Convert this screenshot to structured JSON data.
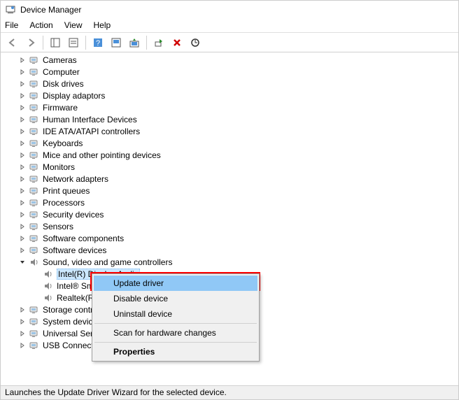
{
  "window": {
    "title": "Device Manager"
  },
  "menu": {
    "file": "File",
    "action": "Action",
    "view": "View",
    "help": "Help"
  },
  "tree": [
    {
      "label": "Cameras",
      "icon": "camera",
      "depth": 1,
      "arrow": "right"
    },
    {
      "label": "Computer",
      "icon": "computer",
      "depth": 1,
      "arrow": "right"
    },
    {
      "label": "Disk drives",
      "icon": "disk",
      "depth": 1,
      "arrow": "right"
    },
    {
      "label": "Display adaptors",
      "icon": "display",
      "depth": 1,
      "arrow": "right"
    },
    {
      "label": "Firmware",
      "icon": "chip",
      "depth": 1,
      "arrow": "right"
    },
    {
      "label": "Human Interface Devices",
      "icon": "hid",
      "depth": 1,
      "arrow": "right"
    },
    {
      "label": "IDE ATA/ATAPI controllers",
      "icon": "ide",
      "depth": 1,
      "arrow": "right"
    },
    {
      "label": "Keyboards",
      "icon": "keyboard",
      "depth": 1,
      "arrow": "right"
    },
    {
      "label": "Mice and other pointing devices",
      "icon": "mouse",
      "depth": 1,
      "arrow": "right"
    },
    {
      "label": "Monitors",
      "icon": "monitor",
      "depth": 1,
      "arrow": "right"
    },
    {
      "label": "Network adapters",
      "icon": "network",
      "depth": 1,
      "arrow": "right"
    },
    {
      "label": "Print queues",
      "icon": "printer",
      "depth": 1,
      "arrow": "right"
    },
    {
      "label": "Processors",
      "icon": "cpu",
      "depth": 1,
      "arrow": "right"
    },
    {
      "label": "Security devices",
      "icon": "security",
      "depth": 1,
      "arrow": "right"
    },
    {
      "label": "Sensors",
      "icon": "sensor",
      "depth": 1,
      "arrow": "right"
    },
    {
      "label": "Software components",
      "icon": "software",
      "depth": 1,
      "arrow": "right"
    },
    {
      "label": "Software devices",
      "icon": "software",
      "depth": 1,
      "arrow": "right"
    },
    {
      "label": "Sound, video and game controllers",
      "icon": "sound",
      "depth": 1,
      "arrow": "down"
    },
    {
      "label": "Intel(R) Display Audio",
      "icon": "sound",
      "depth": 2,
      "arrow": "none",
      "selected": true
    },
    {
      "label": "Intel® Sm",
      "icon": "sound",
      "depth": 2,
      "arrow": "none",
      "cut": true
    },
    {
      "label": "Realtek(R)",
      "icon": "sound",
      "depth": 2,
      "arrow": "none",
      "cut": true
    },
    {
      "label": "Storage contr",
      "icon": "storage",
      "depth": 1,
      "arrow": "right",
      "cut": true
    },
    {
      "label": "System device",
      "icon": "system",
      "depth": 1,
      "arrow": "right",
      "cut": true
    },
    {
      "label": "Universal Seri",
      "icon": "usb",
      "depth": 1,
      "arrow": "right",
      "cut": true
    },
    {
      "label": "USB Connecto",
      "icon": "usb",
      "depth": 1,
      "arrow": "right",
      "cut": true
    }
  ],
  "context_menu": {
    "update": "Update driver",
    "disable": "Disable device",
    "uninstall": "Uninstall device",
    "scan": "Scan for hardware changes",
    "properties": "Properties"
  },
  "status": "Launches the Update Driver Wizard for the selected device."
}
